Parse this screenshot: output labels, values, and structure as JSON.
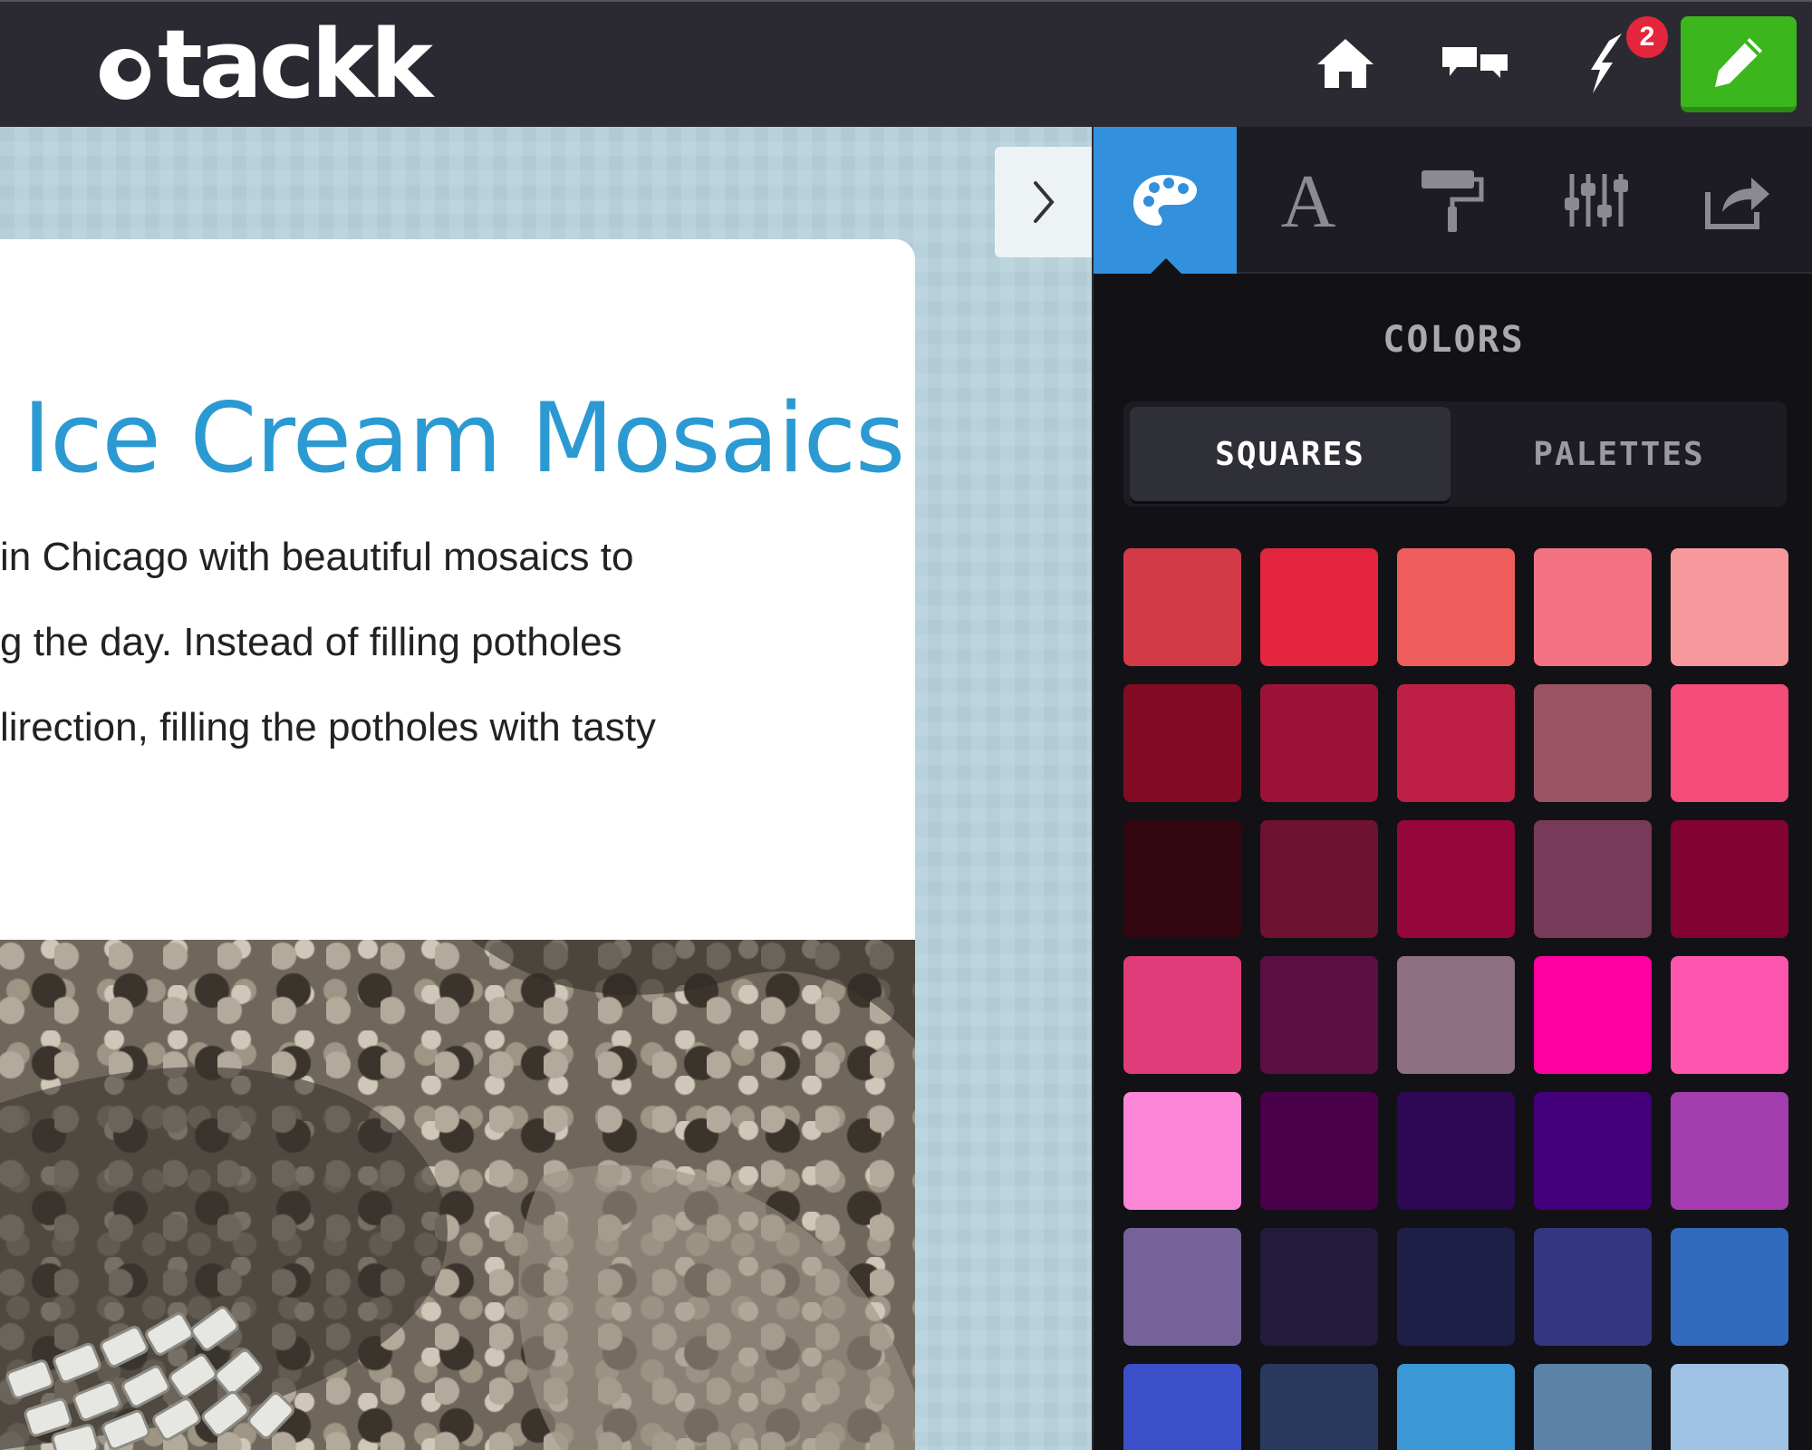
{
  "topbar": {
    "logo_text": "tackk",
    "notification_count": "2",
    "icons": [
      "home-icon",
      "chat-bubbles-icon",
      "lightning-bolt-icon",
      "pencil-icon"
    ]
  },
  "card": {
    "title": "Ice Cream Mosaics",
    "body_lines": [
      "in Chicago with beautiful mosaics to",
      "g the day. Instead of filling potholes",
      "lirection, filling the potholes with tasty"
    ]
  },
  "panel": {
    "tabs": [
      {
        "name": "palette-icon",
        "active": true
      },
      {
        "name": "font-icon",
        "active": false
      },
      {
        "name": "paint-roller-icon",
        "active": false
      },
      {
        "name": "sliders-icon",
        "active": false
      },
      {
        "name": "share-icon",
        "active": false
      }
    ],
    "section_title": "COLORS",
    "segments": {
      "active": "SQUARES",
      "inactive": "PALETTES"
    },
    "swatches": [
      "#d23a47",
      "#e4253f",
      "#ef5e5c",
      "#f37283",
      "#f7999c",
      "#830b24",
      "#9b1339",
      "#be1f44",
      "#995564",
      "#f44b78",
      "#330711",
      "#6d1230",
      "#97063a",
      "#783a59",
      "#820232",
      "#df3c79",
      "#5c0f45",
      "#8d6f81",
      "#ff00a0",
      "#fc56ae",
      "#fb85d7",
      "#4a004a",
      "#2e0755",
      "#44007b",
      "#a43db0",
      "#766299",
      "#231b3c",
      "#1e1f47",
      "#34367f",
      "#326bbd",
      "#3b50c8",
      "#2a3a5e",
      "#3b98d4",
      "#5c82a8",
      "#9fc1e3"
    ]
  },
  "colors": {
    "topbar": "#2b2a33",
    "accent_blue": "#3390dc",
    "edit_green": "#3bb61d",
    "title_blue": "#2b9ad2",
    "badge_red": "#e3263b"
  }
}
